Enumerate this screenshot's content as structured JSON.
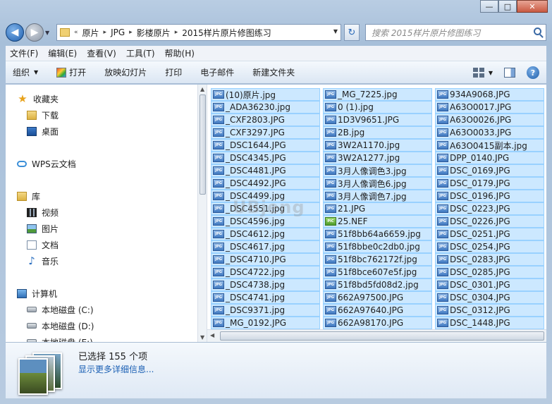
{
  "window": {
    "caption_buttons": {
      "minimize": "—",
      "maximize": "□",
      "close": "✕"
    }
  },
  "address_bar": {
    "prefix": "«",
    "crumbs": [
      "原片",
      "JPG",
      "影楼原片",
      "2015样片原片修图练习"
    ],
    "separator": "▸"
  },
  "search": {
    "placeholder": "搜索 2015样片原片修图练习"
  },
  "menu": [
    "文件(F)",
    "编辑(E)",
    "查看(V)",
    "工具(T)",
    "帮助(H)"
  ],
  "toolbar": {
    "organize": "组织",
    "open": "打开",
    "slideshow": "放映幻灯片",
    "print": "打印",
    "email": "电子邮件",
    "new_folder": "新建文件夹"
  },
  "nav_pane": {
    "favorites": "收藏夹",
    "downloads": "下载",
    "desktop": "桌面",
    "wps": "WPS云文档",
    "libraries": "库",
    "videos": "视频",
    "pictures": "图片",
    "documents": "文档",
    "music": "音乐",
    "computer": "计算机",
    "drive_c": "本地磁盘 (C:)",
    "drive_d": "本地磁盘 (D:)",
    "drive_e": "本地磁盘 (E:)"
  },
  "file_icon_label": "JPG",
  "nef_icon_label": "PIC",
  "files": {
    "col1": [
      "(10)原片.jpg",
      "_ADA36230.jpg",
      "_CXF2803.JPG",
      "_CXF3297.JPG",
      "_DSC1644.JPG",
      "_DSC4345.JPG",
      "_DSC4481.JPG",
      "_DSC4492.JPG",
      "_DSC4499.jpg",
      "_DSC4551.jpg",
      "_DSC4596.jpg",
      "_DSC4612.jpg",
      "_DSC4617.jpg",
      "_DSC4710.JPG",
      "_DSC4722.jpg",
      "_DSC4738.jpg",
      "_DSC4741.jpg",
      "_DSC9371.jpg",
      "_MG_0192.JPG"
    ],
    "col2": [
      "_MG_7225.jpg",
      "0 (1).jpg",
      "1D3V9651.JPG",
      "2B.jpg",
      "3W2A1170.jpg",
      "3W2A1277.jpg",
      "3月人像调色3.jpg",
      "3月人像调色6.jpg",
      "3月人像调色7.jpg",
      "21.JPG",
      "25.NEF",
      "51f8bb64a6659.jpg",
      "51f8bbe0c2db0.jpg",
      "51f8bc762172f.jpg",
      "51f8bce607e5f.jpg",
      "51f8bd5fd08d2.jpg",
      "662A97500.JPG",
      "662A97640.JPG",
      "662A98170.JPG"
    ],
    "col3": [
      "934A9068.JPG",
      "A63O0017.JPG",
      "A63O0026.JPG",
      "A63O0033.JPG",
      "A63O0415副本.jpg",
      "DPP_0140.JPG",
      "DSC_0169.JPG",
      "DSC_0179.JPG",
      "DSC_0196.JPG",
      "DSC_0223.JPG",
      "DSC_0226.JPG",
      "DSC_0251.JPG",
      "DSC_0254.JPG",
      "DSC_0283.JPG",
      "DSC_0285.JPG",
      "DSC_0301.JPG",
      "DSC_0304.JPG",
      "DSC_0312.JPG",
      "DSC_1448.JPG"
    ]
  },
  "watermark": "UBjeng",
  "details": {
    "selection": "已选择 155 个项",
    "more_info": "显示更多详细信息..."
  }
}
